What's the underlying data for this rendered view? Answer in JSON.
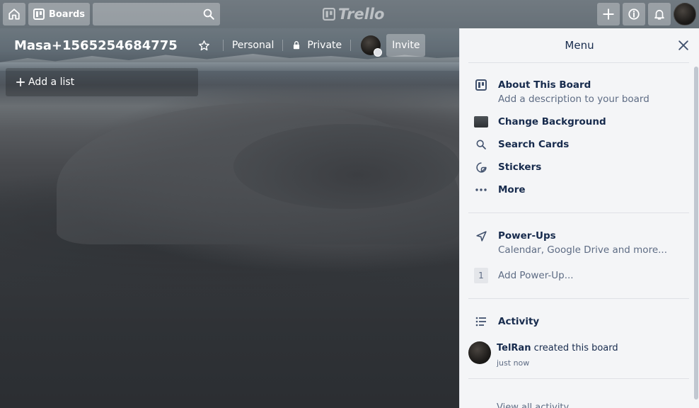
{
  "header": {
    "boards_label": "Boards",
    "logo_text": "Trello",
    "icons": {
      "home": "home-icon",
      "boards": "boards-icon",
      "search": "search-icon",
      "create": "plus-icon",
      "info": "info-icon",
      "notifications": "bell-icon"
    }
  },
  "board": {
    "title": "Masa+1565254684775",
    "team_label": "Personal",
    "visibility_label": "Private",
    "invite_label": "Invite",
    "add_list_label": "Add a list"
  },
  "menu": {
    "title": "Menu",
    "about": {
      "title": "About This Board",
      "subtitle": "Add a description to your board"
    },
    "change_background": "Change Background",
    "search_cards": "Search Cards",
    "stickers": "Stickers",
    "more": "More",
    "powerups": {
      "title": "Power-Ups",
      "subtitle": "Calendar, Google Drive and more..."
    },
    "add_powerup": {
      "count": "1",
      "label": "Add Power-Up..."
    },
    "activity": {
      "title": "Activity",
      "entries": [
        {
          "user": "TelRan",
          "action": "created this board",
          "time": "just now"
        }
      ],
      "view_all": "View all activity..."
    }
  },
  "colors": {
    "menu_bg": "#f4f5f7",
    "text_primary": "#172b4d",
    "text_secondary": "#5e6c84"
  }
}
